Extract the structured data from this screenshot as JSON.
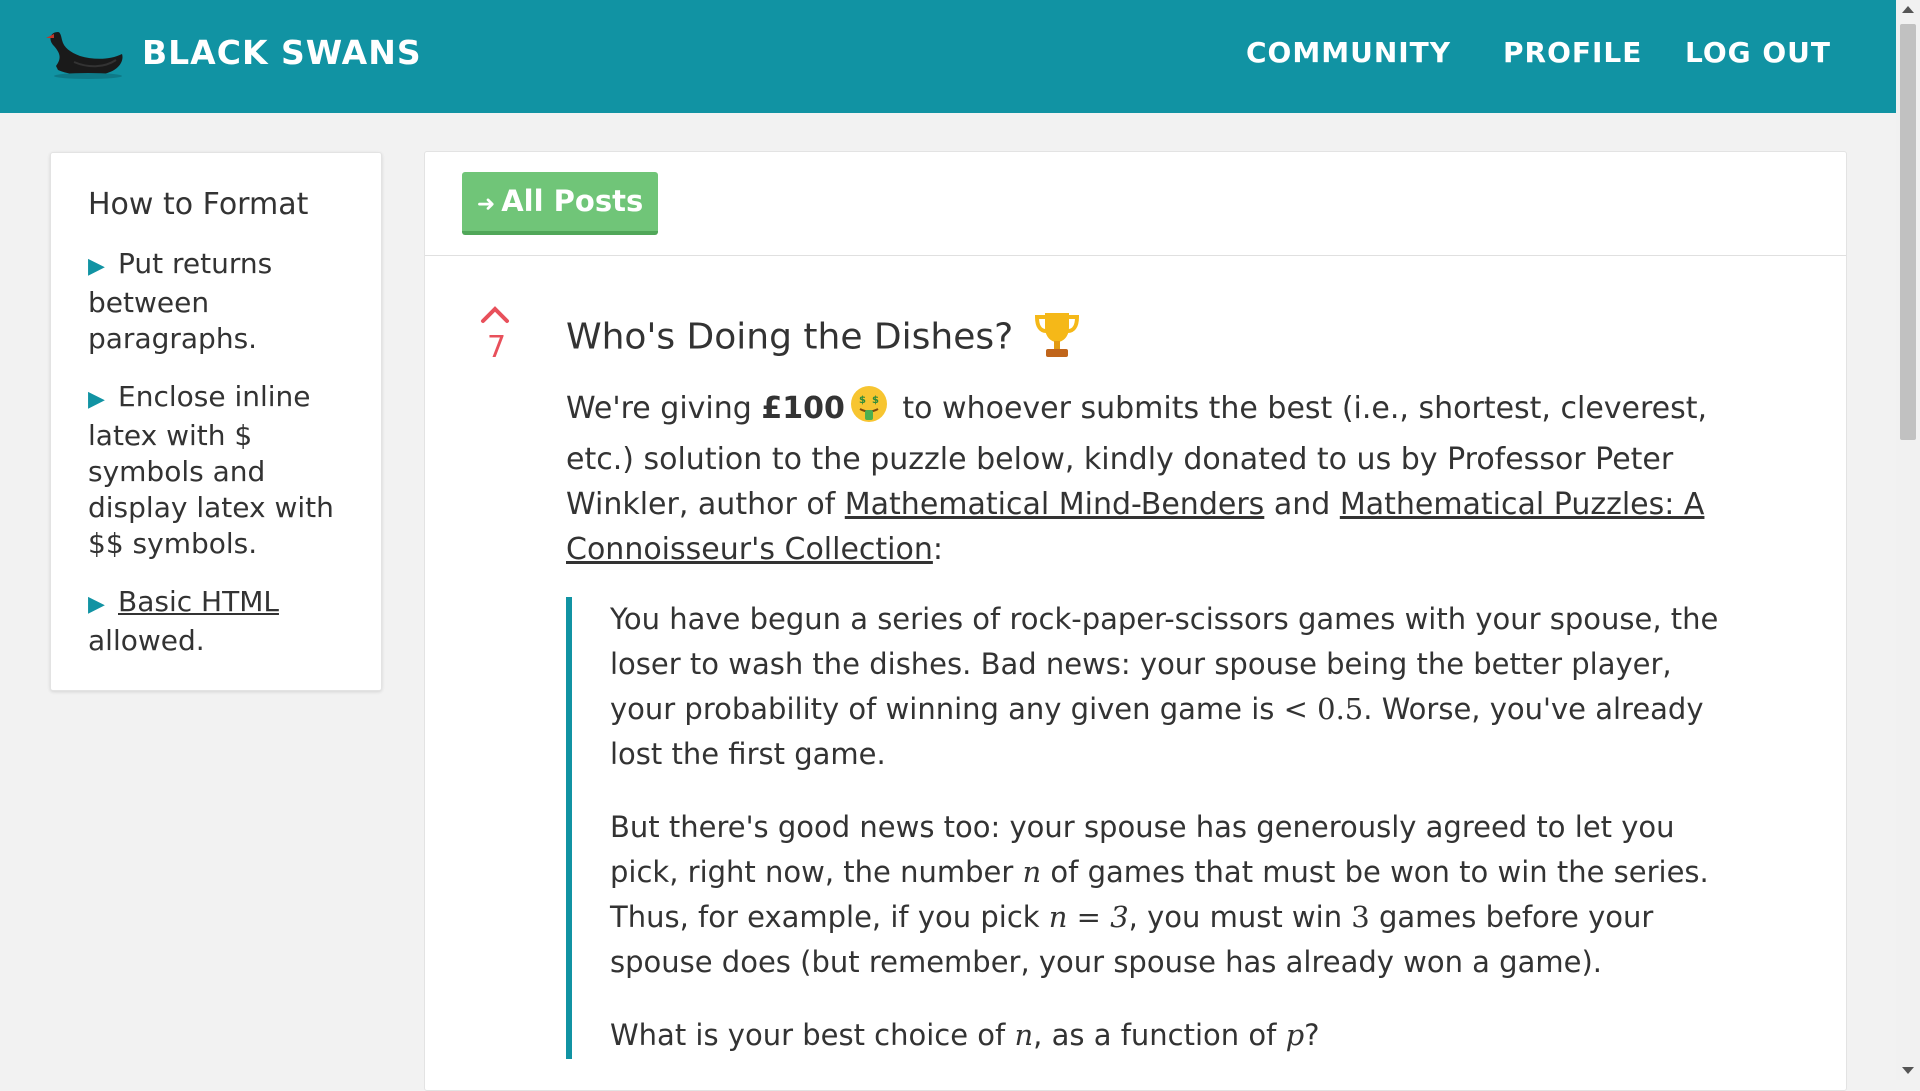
{
  "header": {
    "brand": "BLACK SWANS",
    "nav": [
      "COMMUNITY",
      "PROFILE",
      "LOG OUT"
    ]
  },
  "sidebar": {
    "title": "How to Format",
    "items": [
      {
        "text": "Put returns between paragraphs."
      },
      {
        "text": "Enclose inline latex with $ symbols and display latex with $$ symbols."
      },
      {
        "link": "Basic HTML",
        "text": " allowed."
      }
    ]
  },
  "toolbar": {
    "back_label": "All Posts"
  },
  "post": {
    "votes": "7",
    "title": "Who's Doing the Dishes?",
    "intro": {
      "p1": "We're giving ",
      "prize": "£100",
      "p2": " to whoever submits the best (i.e., shortest, cleverest, etc.) solution to the puzzle below, kindly donated to us by Professor Peter Winkler, author of ",
      "book1": "Mathematical Mind-Benders",
      "and": " and ",
      "book2": "Mathematical Puzzles: A Connoisseur's Collection",
      "end": ":"
    },
    "quote": {
      "q1a": "You have begun a series of rock-paper-scissors games with your spouse, the loser to wash the dishes. Bad news: your spouse being the better player, your probability of winning any given game is ",
      "q1math": "< 0.5",
      "q1b": ". Worse, you've already lost the first game.",
      "q2a": "But there's good news too: your spouse has generously agreed to let you pick, right now, the number ",
      "q2n": "n",
      "q2b": " of games that must be won to win the series. Thus, for example, if you pick ",
      "q2eq": "n = 3",
      "q2c": ", you must win ",
      "q2three": "3",
      "q2d": " games before your spouse does (but remember, your spouse has already won a game).",
      "q3a": "What is your best choice of ",
      "q3n": "n",
      "q3b": ", as a function of ",
      "q3p": "p",
      "q3c": "?"
    }
  },
  "colors": {
    "header": "#1193a3",
    "button": "#70c578",
    "vote": "#e8505b",
    "quote_border": "#1193a3"
  }
}
